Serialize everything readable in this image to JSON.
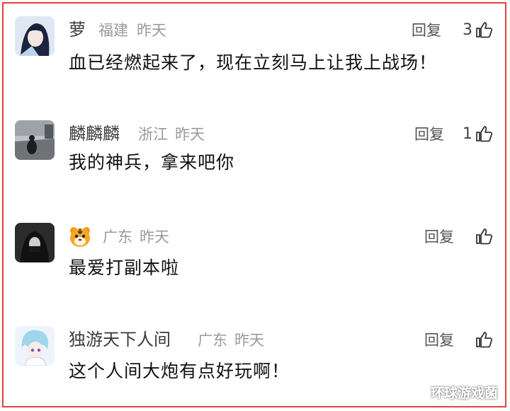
{
  "comments": [
    {
      "name": "萝",
      "region": "福建",
      "time": "昨天",
      "reply_label": "回复",
      "likes": "3",
      "text": "血已经燃起来了，现在立刻马上让我上战场！"
    },
    {
      "name": "麟麟麟",
      "region": "浙江",
      "time": "昨天",
      "reply_label": "回复",
      "likes": "1",
      "text": "我的神兵，拿来吧你"
    },
    {
      "name": "",
      "region": "广东",
      "time": "昨天",
      "reply_label": "回复",
      "likes": "",
      "text": "最爱打副本啦"
    },
    {
      "name": "独游天下人间",
      "region": "广东",
      "time": "昨天",
      "reply_label": "回复",
      "likes": "",
      "text": "这个人间大炮有点好玩啊！"
    }
  ],
  "watermark": "环球游戏菌",
  "colors": {
    "frame_border": "#e0443e",
    "text": "#111111",
    "meta": "#9a9a9a"
  },
  "icons": [
    "thumbs-up-icon",
    "tiger-badge-icon"
  ]
}
